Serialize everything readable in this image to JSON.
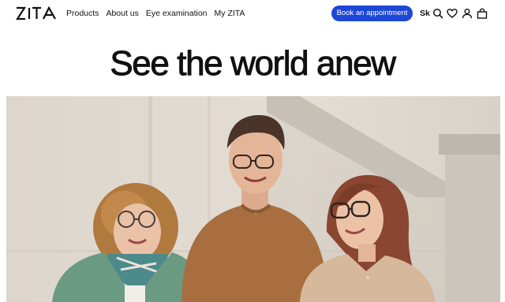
{
  "header": {
    "logo_text": "ZITA",
    "nav": [
      {
        "label": "Products"
      },
      {
        "label": "About us"
      },
      {
        "label": "Eye examination"
      },
      {
        "label": "My ZITA"
      }
    ],
    "cta_label": "Book an appointment",
    "language": "Sk",
    "icons": [
      "search-icon",
      "heart-icon",
      "user-icon",
      "bag-icon"
    ]
  },
  "hero": {
    "headline": "See the world anew",
    "image_description": "photo"
  },
  "colors": {
    "accent": "#1d47d6",
    "text": "#111111",
    "wall": "#ded7cd",
    "sweater_left": "#6b9a82",
    "sweater_middle": "#a86e3f",
    "sweater_right": "#d6b89c"
  }
}
